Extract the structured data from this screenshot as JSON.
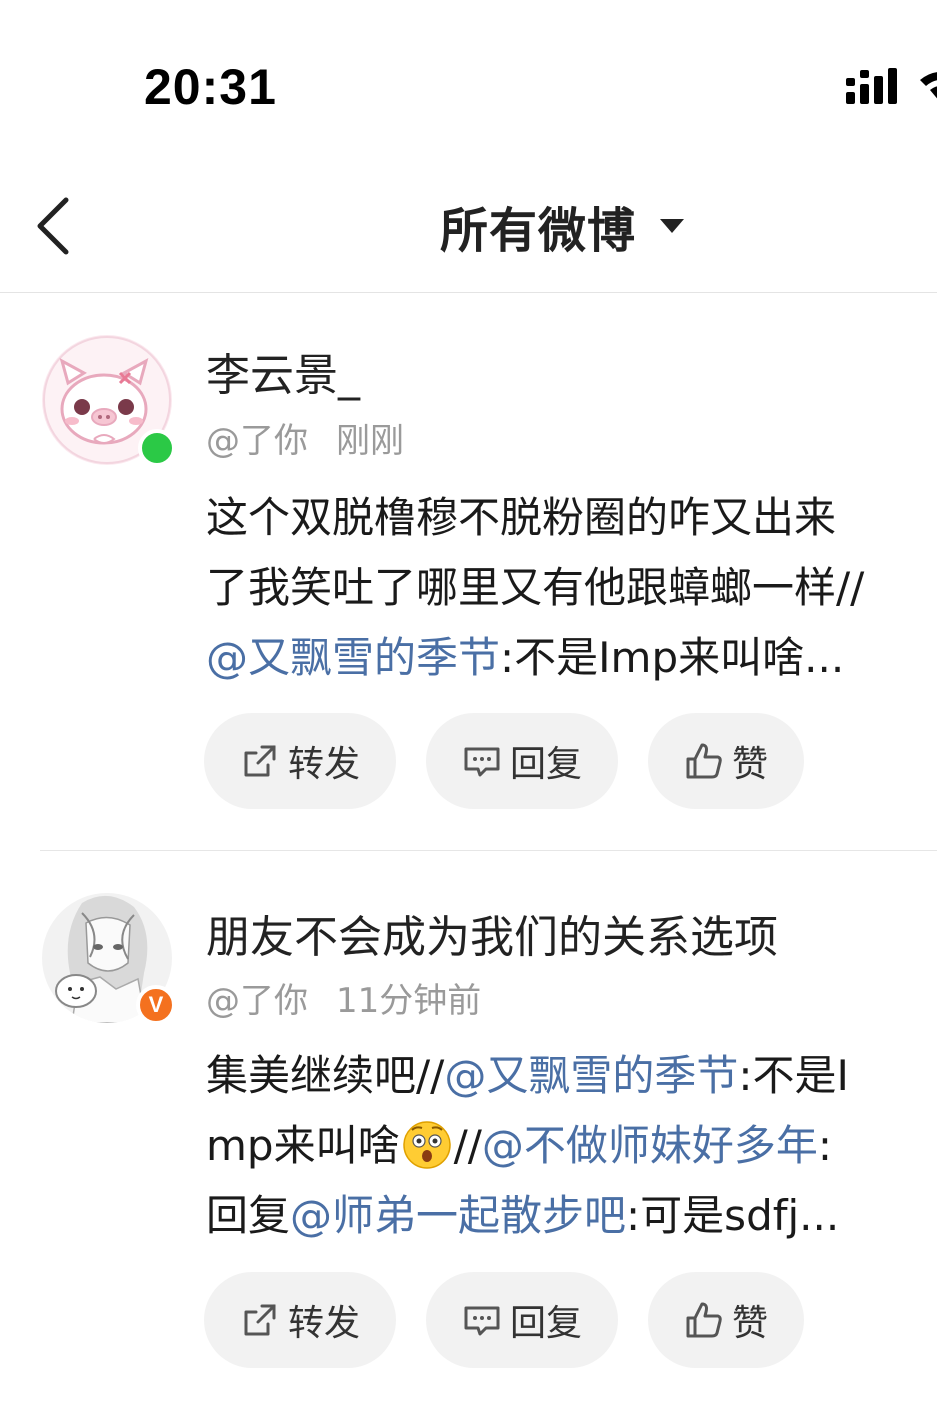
{
  "status_bar": {
    "time": "20:31"
  },
  "nav": {
    "title": "所有微博"
  },
  "feed": [
    {
      "username": "李云景_",
      "mention_me": "@了你",
      "time": "刚刚",
      "content_lines": [
        [
          {
            "t": "这个双脱橹穆不脱粉圈的咋又出来",
            "m": false
          }
        ],
        [
          {
            "t": "了我笑吐了哪里又有他跟蟑螂一样//",
            "m": false
          }
        ],
        [
          {
            "t": "@又飘雪的季节",
            "m": true
          },
          {
            "t": ":不是Imp来叫啥...",
            "m": false
          }
        ]
      ],
      "actions": {
        "repost": "转发",
        "reply": "回复",
        "like": "赞"
      }
    },
    {
      "username": "朋友不会成为我们的关系选项",
      "mention_me": "@了你",
      "time": "11分钟前",
      "content_lines": [
        [
          {
            "t": "集美继续吧//",
            "m": false
          },
          {
            "t": "@又飘雪的季节",
            "m": true
          },
          {
            "t": ":不是I",
            "m": false
          }
        ],
        [
          {
            "t": "mp来叫啥",
            "m": false
          },
          {
            "t": "[吃惊]",
            "emoji": true
          },
          {
            "t": "//",
            "m": false
          },
          {
            "t": "@不做师妹好多年",
            "m": true
          },
          {
            "t": ":",
            "m": false
          }
        ],
        [
          {
            "t": "回复",
            "m": false
          },
          {
            "t": "@师弟一起散步吧",
            "m": true
          },
          {
            "t": ":可是sdfj...",
            "m": false
          }
        ]
      ],
      "actions": {
        "repost": "转发",
        "reply": "回复",
        "like": "赞"
      }
    }
  ],
  "colors": {
    "mention": "#4a6fa5",
    "online": "#2bc946",
    "verified": "#f4711f",
    "button_bg": "#f2f2f2"
  },
  "icons": [
    "back-arrow-icon",
    "dropdown-caret-icon",
    "signal-icon",
    "repost-icon",
    "comment-icon",
    "like-icon",
    "surprised-emoji-icon"
  ]
}
